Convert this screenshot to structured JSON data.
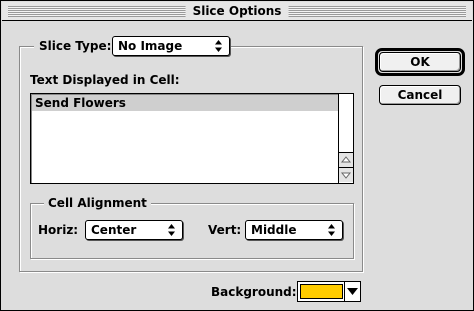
{
  "window": {
    "title": "Slice Options"
  },
  "slice_type": {
    "label": "Slice Type:",
    "value": "No Image"
  },
  "text_cell": {
    "label": "Text Displayed in Cell:",
    "lines": [
      "Send Flowers"
    ]
  },
  "cell_alignment": {
    "label": "Cell Alignment",
    "horiz_label": "Horiz:",
    "horiz_value": "Center",
    "vert_label": "Vert:",
    "vert_value": "Middle"
  },
  "buttons": {
    "ok": "OK",
    "cancel": "Cancel"
  },
  "background": {
    "label": "Background:",
    "color": "#ffcc00"
  },
  "icons": {
    "popup": "up-down-arrows-icon",
    "scroll_up": "scroll-up-arrow-icon",
    "scroll_down": "scroll-down-arrow-icon",
    "swatch_drop": "dropdown-triangle-icon"
  }
}
